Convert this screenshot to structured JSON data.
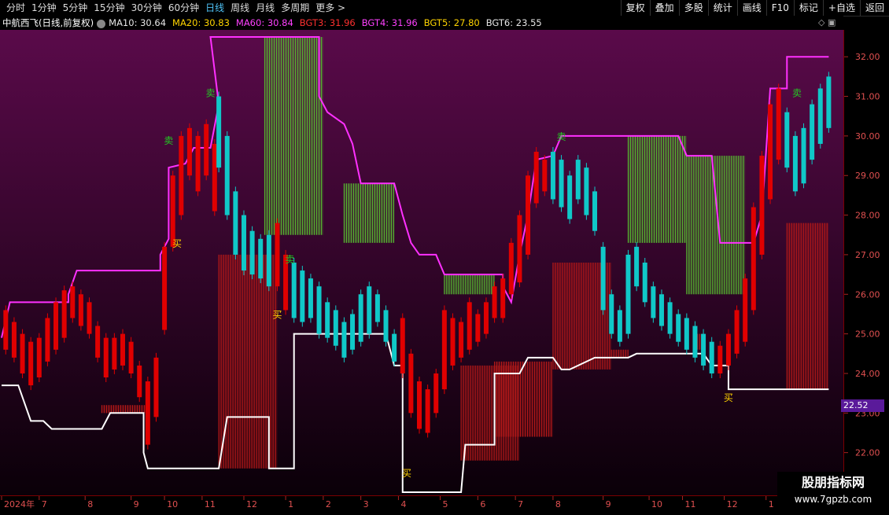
{
  "toolbar": {
    "periods": [
      "分时",
      "1分钟",
      "5分钟",
      "15分钟",
      "30分钟",
      "60分钟",
      "日线",
      "周线",
      "月线",
      "多周期",
      "更多 >"
    ],
    "active": "日线",
    "buttons": [
      "复权",
      "叠加",
      "多股",
      "统计",
      "画线",
      "F10",
      "标记",
      "+自选",
      "返回"
    ]
  },
  "legend": {
    "stock": "中航西飞(日线,前复权)",
    "items": [
      {
        "label": "MA10: 30.64",
        "color": "#e6e6e6"
      },
      {
        "label": "MA20: 30.83",
        "color": "#ffd400"
      },
      {
        "label": "MA60: 30.84",
        "color": "#ff40ff"
      },
      {
        "label": "BGT3: 31.96",
        "color": "#ff3030"
      },
      {
        "label": "BGT4: 31.96",
        "color": "#ff40ff"
      },
      {
        "label": "BGT5: 27.80",
        "color": "#ffd400"
      },
      {
        "label": "BGT6: 23.55",
        "color": "#e6e6e6"
      }
    ]
  },
  "current_price": "22.52",
  "watermark": {
    "name": "股朋指标网",
    "url": "www.7gpzb.com"
  },
  "colors": {
    "up": "#e00000",
    "down": "#10c8c8",
    "upper": "#ff30ff",
    "lower": "#ffffff",
    "fill_red": "#b01818",
    "fill_green": "#55b030",
    "bg_top": "#5a0a4a",
    "bg_bottom": "#0a0008"
  },
  "chart_data": {
    "type": "candlestick",
    "ylim": [
      21.0,
      32.6
    ],
    "yticks": [
      22.0,
      23.0,
      24.0,
      25.0,
      26.0,
      27.0,
      28.0,
      29.0,
      30.0,
      31.0,
      32.0
    ],
    "xtick_labels": [
      "2024年",
      "7",
      "8",
      "9",
      "10",
      "11",
      "12",
      "1",
      "2",
      "3",
      "4",
      "5",
      "6",
      "7",
      "8",
      "9",
      "10",
      "11",
      "12",
      "1"
    ],
    "xtick_frac": [
      0.0,
      0.045,
      0.1,
      0.155,
      0.195,
      0.24,
      0.29,
      0.34,
      0.385,
      0.43,
      0.475,
      0.525,
      0.57,
      0.615,
      0.66,
      0.72,
      0.775,
      0.815,
      0.865,
      0.915
    ],
    "upper_band": [
      [
        0,
        24.9
      ],
      [
        0.01,
        25.8
      ],
      [
        0.08,
        25.8
      ],
      [
        0.08,
        26.0
      ],
      [
        0.09,
        26.6
      ],
      [
        0.19,
        26.6
      ],
      [
        0.19,
        27.0
      ],
      [
        0.2,
        27.4
      ],
      [
        0.2,
        29.2
      ],
      [
        0.22,
        29.3
      ],
      [
        0.23,
        29.7
      ],
      [
        0.25,
        29.7
      ],
      [
        0.26,
        30.8
      ],
      [
        0.25,
        32.5
      ],
      [
        0.38,
        32.5
      ],
      [
        0.38,
        31.0
      ],
      [
        0.39,
        30.6
      ],
      [
        0.41,
        30.3
      ],
      [
        0.42,
        29.8
      ],
      [
        0.43,
        28.8
      ],
      [
        0.47,
        28.8
      ],
      [
        0.48,
        28.0
      ],
      [
        0.49,
        27.3
      ],
      [
        0.5,
        27.0
      ],
      [
        0.52,
        27.0
      ],
      [
        0.53,
        26.5
      ],
      [
        0.6,
        26.5
      ],
      [
        0.6,
        26.2
      ],
      [
        0.61,
        25.8
      ],
      [
        0.62,
        27.0
      ],
      [
        0.63,
        28.0
      ],
      [
        0.64,
        29.4
      ],
      [
        0.66,
        29.5
      ],
      [
        0.67,
        30.0
      ],
      [
        0.81,
        30.0
      ],
      [
        0.82,
        29.5
      ],
      [
        0.85,
        29.5
      ],
      [
        0.86,
        27.3
      ],
      [
        0.9,
        27.3
      ],
      [
        0.91,
        28.0
      ],
      [
        0.92,
        31.2
      ],
      [
        0.94,
        31.2
      ],
      [
        0.94,
        32.0
      ],
      [
        0.99,
        32.0
      ]
    ],
    "lower_band": [
      [
        0,
        23.7
      ],
      [
        0.02,
        23.7
      ],
      [
        0.035,
        22.8
      ],
      [
        0.05,
        22.8
      ],
      [
        0.06,
        22.6
      ],
      [
        0.12,
        22.6
      ],
      [
        0.13,
        23.0
      ],
      [
        0.17,
        23.0
      ],
      [
        0.17,
        22.0
      ],
      [
        0.175,
        21.6
      ],
      [
        0.24,
        21.6
      ],
      [
        0.26,
        21.6
      ],
      [
        0.27,
        22.9
      ],
      [
        0.32,
        22.9
      ],
      [
        0.32,
        21.6
      ],
      [
        0.35,
        21.6
      ],
      [
        0.35,
        25.0
      ],
      [
        0.46,
        25.0
      ],
      [
        0.47,
        24.2
      ],
      [
        0.48,
        24.2
      ],
      [
        0.48,
        21.0
      ],
      [
        0.55,
        21.0
      ],
      [
        0.555,
        22.2
      ],
      [
        0.59,
        22.2
      ],
      [
        0.59,
        24.0
      ],
      [
        0.62,
        24.0
      ],
      [
        0.63,
        24.4
      ],
      [
        0.66,
        24.4
      ],
      [
        0.67,
        24.1
      ],
      [
        0.68,
        24.1
      ],
      [
        0.71,
        24.4
      ],
      [
        0.75,
        24.4
      ],
      [
        0.76,
        24.5
      ],
      [
        0.84,
        24.5
      ],
      [
        0.85,
        24.2
      ],
      [
        0.87,
        24.2
      ],
      [
        0.87,
        23.6
      ],
      [
        0.88,
        23.6
      ],
      [
        0.9,
        23.6
      ],
      [
        0.97,
        23.6
      ],
      [
        0.99,
        23.6
      ]
    ],
    "hatch_red": [
      [
        0.12,
        0.175,
        23.0,
        23.2
      ],
      [
        0.26,
        0.33,
        21.6,
        27.0
      ],
      [
        0.55,
        0.62,
        21.8,
        24.2
      ],
      [
        0.59,
        0.66,
        22.4,
        24.3
      ],
      [
        0.66,
        0.73,
        24.1,
        26.8
      ],
      [
        0.73,
        0.75,
        24.4,
        24.6
      ],
      [
        0.83,
        0.84,
        24.6,
        25.0
      ],
      [
        0.94,
        0.99,
        23.6,
        27.8
      ]
    ],
    "hatch_green": [
      [
        0.315,
        0.385,
        27.5,
        32.5
      ],
      [
        0.41,
        0.47,
        27.3,
        28.8
      ],
      [
        0.53,
        0.59,
        26.0,
        26.5
      ],
      [
        0.75,
        0.82,
        27.3,
        30.0
      ],
      [
        0.82,
        0.89,
        26.0,
        29.5
      ]
    ],
    "candles_red": [
      [
        0.005,
        24.6,
        25.6
      ],
      [
        0.015,
        24.4,
        25.3
      ],
      [
        0.025,
        24.0,
        25.0
      ],
      [
        0.035,
        23.7,
        24.8
      ],
      [
        0.045,
        23.9,
        24.9
      ],
      [
        0.055,
        24.3,
        25.4
      ],
      [
        0.065,
        24.6,
        25.8
      ],
      [
        0.075,
        24.9,
        26.1
      ],
      [
        0.085,
        25.4,
        26.2
      ],
      [
        0.095,
        25.2,
        26.0
      ],
      [
        0.105,
        25.0,
        25.8
      ],
      [
        0.115,
        24.4,
        25.2
      ],
      [
        0.125,
        23.9,
        24.9
      ],
      [
        0.135,
        24.1,
        24.9
      ],
      [
        0.145,
        24.2,
        25.0
      ],
      [
        0.155,
        24.0,
        24.8
      ],
      [
        0.165,
        23.4,
        24.2
      ],
      [
        0.175,
        22.2,
        23.8
      ],
      [
        0.185,
        22.9,
        24.4
      ],
      [
        0.195,
        25.1,
        27.2
      ],
      [
        0.205,
        27.2,
        29.0
      ],
      [
        0.215,
        28.0,
        30.0
      ],
      [
        0.225,
        29.0,
        30.2
      ],
      [
        0.235,
        28.6,
        30.0
      ],
      [
        0.245,
        29.0,
        30.3
      ],
      [
        0.255,
        28.1,
        29.8
      ],
      [
        0.33,
        26.2,
        27.8
      ],
      [
        0.34,
        25.6,
        27.0
      ],
      [
        0.48,
        24.0,
        25.4
      ],
      [
        0.49,
        23.0,
        24.5
      ],
      [
        0.5,
        22.6,
        23.8
      ],
      [
        0.51,
        22.5,
        23.6
      ],
      [
        0.52,
        23.0,
        24.0
      ],
      [
        0.53,
        23.6,
        25.6
      ],
      [
        0.54,
        24.2,
        25.4
      ],
      [
        0.55,
        24.4,
        25.3
      ],
      [
        0.56,
        24.6,
        25.8
      ],
      [
        0.57,
        24.8,
        25.5
      ],
      [
        0.58,
        25.0,
        25.8
      ],
      [
        0.59,
        25.4,
        26.2
      ],
      [
        0.6,
        25.4,
        26.4
      ],
      [
        0.61,
        26.0,
        27.3
      ],
      [
        0.62,
        26.3,
        28.0
      ],
      [
        0.63,
        27.0,
        29.0
      ],
      [
        0.64,
        28.3,
        29.6
      ],
      [
        0.65,
        28.6,
        29.4
      ],
      [
        0.86,
        24.0,
        24.7
      ],
      [
        0.87,
        24.2,
        25.0
      ],
      [
        0.88,
        24.5,
        25.6
      ],
      [
        0.89,
        24.8,
        26.4
      ],
      [
        0.9,
        25.6,
        28.2
      ],
      [
        0.91,
        27.0,
        29.5
      ],
      [
        0.92,
        28.4,
        30.8
      ],
      [
        0.93,
        29.4,
        31.2
      ]
    ],
    "candles_cyan": [
      [
        0.26,
        29.2,
        31.0
      ],
      [
        0.27,
        28.0,
        30.0
      ],
      [
        0.28,
        27.0,
        28.6
      ],
      [
        0.29,
        26.6,
        28.0
      ],
      [
        0.3,
        26.5,
        27.6
      ],
      [
        0.31,
        26.4,
        27.4
      ],
      [
        0.32,
        26.2,
        27.5
      ],
      [
        0.35,
        25.4,
        26.8
      ],
      [
        0.36,
        25.3,
        26.6
      ],
      [
        0.37,
        25.4,
        26.4
      ],
      [
        0.38,
        25.0,
        26.2
      ],
      [
        0.39,
        24.9,
        25.8
      ],
      [
        0.4,
        24.7,
        25.6
      ],
      [
        0.41,
        24.4,
        25.3
      ],
      [
        0.42,
        24.6,
        25.5
      ],
      [
        0.43,
        24.8,
        26.0
      ],
      [
        0.44,
        25.0,
        26.2
      ],
      [
        0.45,
        25.3,
        26.0
      ],
      [
        0.46,
        24.8,
        25.6
      ],
      [
        0.47,
        24.3,
        25.0
      ],
      [
        0.66,
        28.4,
        29.6
      ],
      [
        0.67,
        28.2,
        29.4
      ],
      [
        0.68,
        27.9,
        29.0
      ],
      [
        0.69,
        28.4,
        29.4
      ],
      [
        0.7,
        28.0,
        29.2
      ],
      [
        0.71,
        27.6,
        28.6
      ],
      [
        0.72,
        25.6,
        27.2
      ],
      [
        0.73,
        25.0,
        26.0
      ],
      [
        0.74,
        24.8,
        25.6
      ],
      [
        0.75,
        25.0,
        27.0
      ],
      [
        0.76,
        26.2,
        27.2
      ],
      [
        0.77,
        25.8,
        26.8
      ],
      [
        0.78,
        25.4,
        26.2
      ],
      [
        0.79,
        25.2,
        26.0
      ],
      [
        0.8,
        25.0,
        25.8
      ],
      [
        0.81,
        24.8,
        25.5
      ],
      [
        0.82,
        24.6,
        25.4
      ],
      [
        0.83,
        24.4,
        25.2
      ],
      [
        0.84,
        24.2,
        25.0
      ],
      [
        0.85,
        24.0,
        24.8
      ],
      [
        0.94,
        29.2,
        30.6
      ],
      [
        0.95,
        28.6,
        30.0
      ],
      [
        0.96,
        28.8,
        30.2
      ],
      [
        0.97,
        29.4,
        30.8
      ],
      [
        0.98,
        29.8,
        31.2
      ],
      [
        0.99,
        30.2,
        31.5
      ]
    ],
    "signals": [
      {
        "label": "卖",
        "color": "#22cc22",
        "x": 0.2,
        "y": 29.8
      },
      {
        "label": "买",
        "color": "#ffd400",
        "x": 0.21,
        "y": 27.2
      },
      {
        "label": "卖",
        "color": "#22cc22",
        "x": 0.25,
        "y": 31.0
      },
      {
        "label": "卖",
        "color": "#22cc22",
        "x": 0.345,
        "y": 26.8
      },
      {
        "label": "买",
        "color": "#ffd400",
        "x": 0.33,
        "y": 25.4
      },
      {
        "label": "买",
        "color": "#ffd400",
        "x": 0.485,
        "y": 21.4
      },
      {
        "label": "卖",
        "color": "#22cc22",
        "x": 0.67,
        "y": 29.9
      },
      {
        "label": "买",
        "color": "#ffd400",
        "x": 0.87,
        "y": 23.3
      },
      {
        "label": "卖",
        "color": "#22cc22",
        "x": 0.952,
        "y": 31.0
      }
    ]
  }
}
